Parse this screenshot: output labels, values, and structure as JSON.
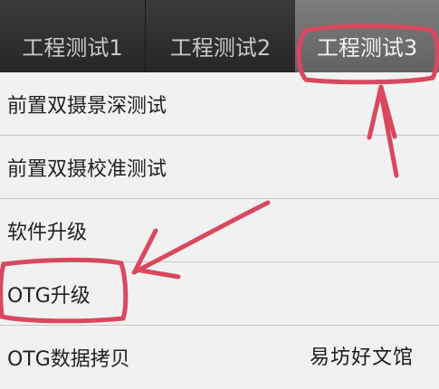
{
  "tabs": [
    {
      "label": "工程测试1"
    },
    {
      "label": "工程测试2"
    },
    {
      "label": "工程测试3"
    }
  ],
  "menu": {
    "items": [
      {
        "label": "前置双摄景深测试"
      },
      {
        "label": "前置双摄校准测试"
      },
      {
        "label": "软件升级"
      },
      {
        "label": "OTG升级"
      },
      {
        "label": "OTG数据拷贝"
      }
    ]
  },
  "watermark": "易坊好文馆",
  "colors": {
    "tab_bar": "#2f2f2f",
    "active_tab": "#6f6f6f",
    "annotation": "#d9485f"
  }
}
